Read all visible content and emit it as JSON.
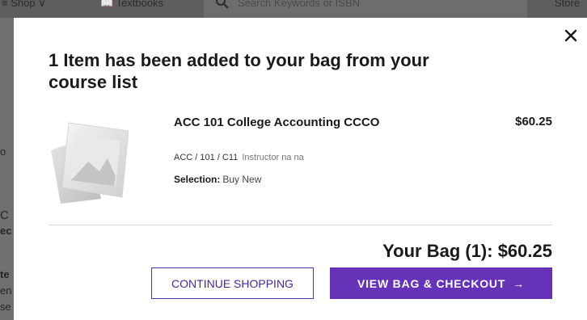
{
  "background": {
    "nav": {
      "shop": "≡ Shop ∨",
      "textbooks": "📖 Textbooks"
    },
    "search_placeholder": "Search Keywords or ISBN",
    "store_link": "Store",
    "left_fragments": [
      "o",
      "C",
      "ec",
      "te",
      "en",
      "se"
    ]
  },
  "modal": {
    "title": "1 Item has been added to your bag from your course list",
    "item": {
      "name": "ACC 101 College Accounting CCCO",
      "price": "$60.25",
      "course_code": "ACC / 101 / C11",
      "instructor": "Instructor na na",
      "selection_label": "Selection:",
      "selection_value": "Buy New"
    },
    "bag_total": "Your Bag (1): $60.25",
    "continue_label": "CONTINUE SHOPPING",
    "checkout_label": "VIEW BAG & CHECKOUT",
    "checkout_arrow": "→"
  },
  "colors": {
    "accent": "#6633b8",
    "text": "#1a1a1a",
    "overlay": "#7a7a7a"
  },
  "icons": {
    "close": "close-icon",
    "search": "search-icon",
    "product": "product-placeholder-icon"
  }
}
